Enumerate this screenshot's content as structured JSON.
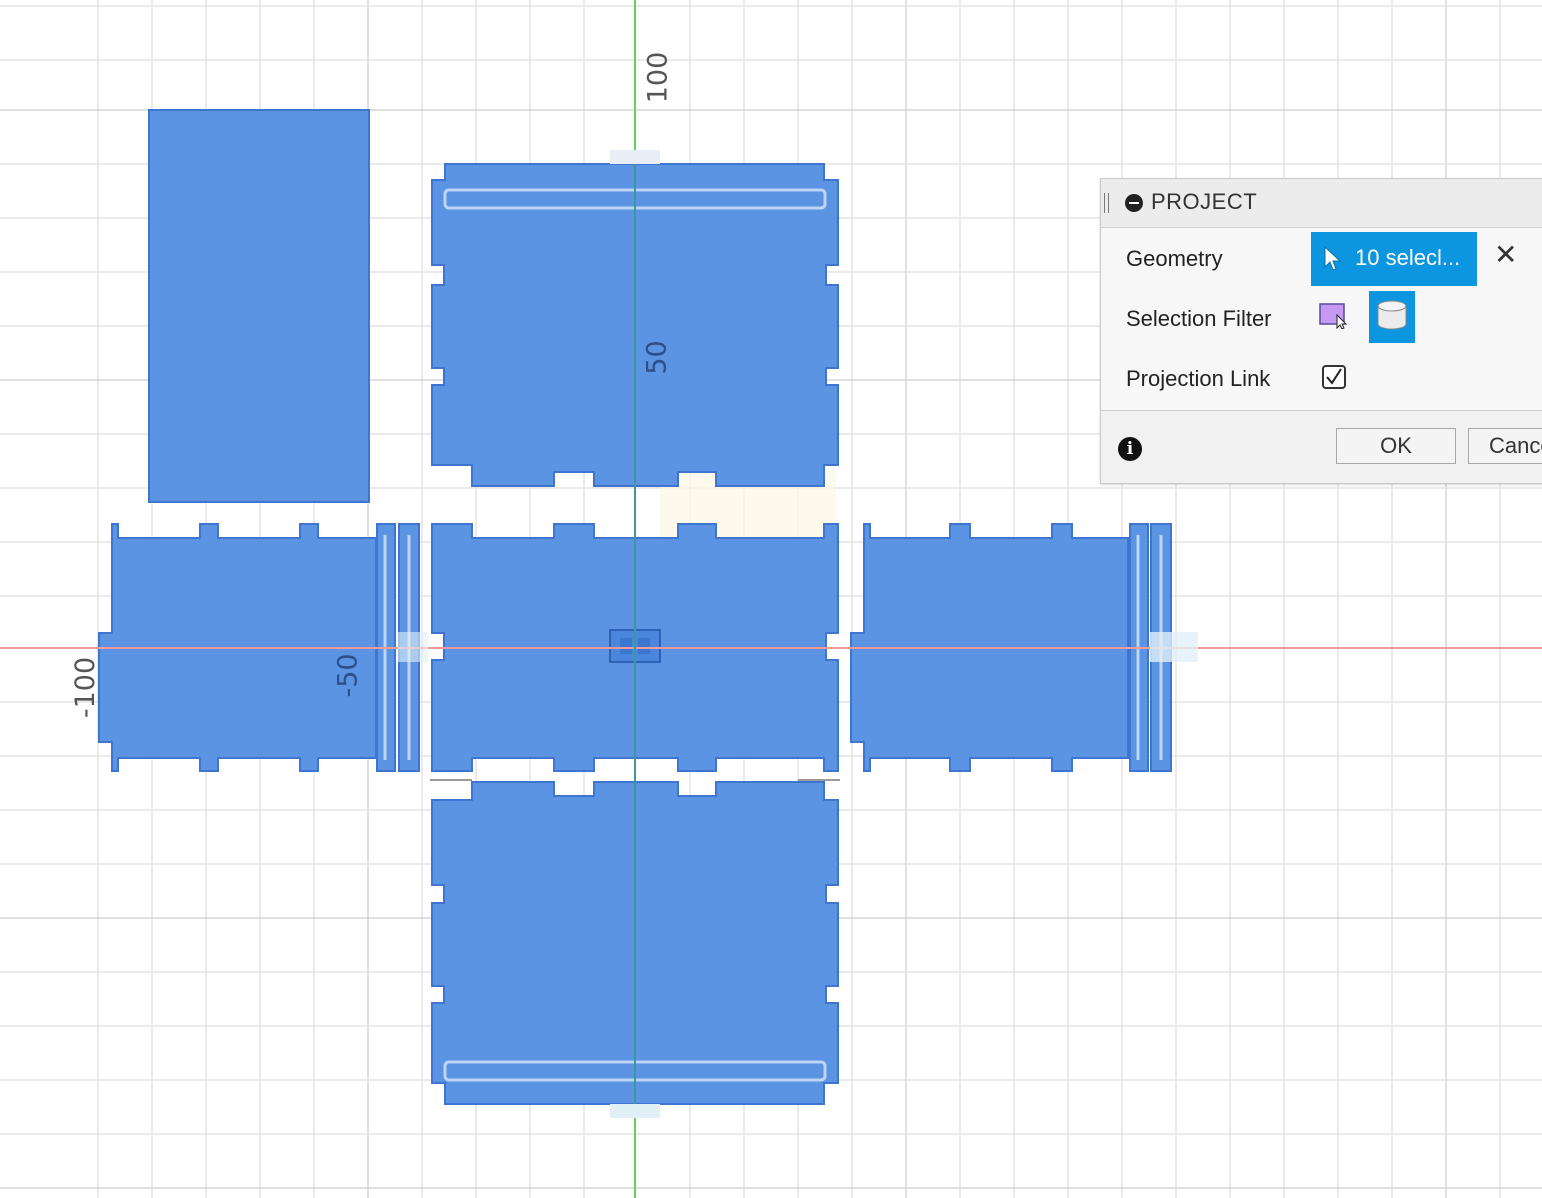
{
  "canvas": {
    "axis_labels": {
      "y_top": "100",
      "y_mid": "50",
      "x_left": "-100",
      "x_mid": "-50"
    },
    "colors": {
      "panel_fill": "#5b94e3",
      "panel_edge": "#3f74cf",
      "grid": "#e3e3e3",
      "x_axis": "#f09a9a",
      "y_axis": "#5fd35f"
    }
  },
  "dialog": {
    "title": "PROJECT",
    "geometry_label": "Geometry",
    "geometry_value": "10 selecl...",
    "selection_filter_label": "Selection Filter",
    "projection_link_label": "Projection Link",
    "projection_link_checked": true,
    "ok_label": "OK",
    "cancel_label": "Cancel",
    "icons": {
      "collapse": "minus-circle-icon",
      "geometry": "cursor-arrow-icon",
      "clear": "close-icon",
      "filter_face": "face-filter-icon",
      "filter_body": "body-filter-icon",
      "info": "info-icon"
    }
  }
}
